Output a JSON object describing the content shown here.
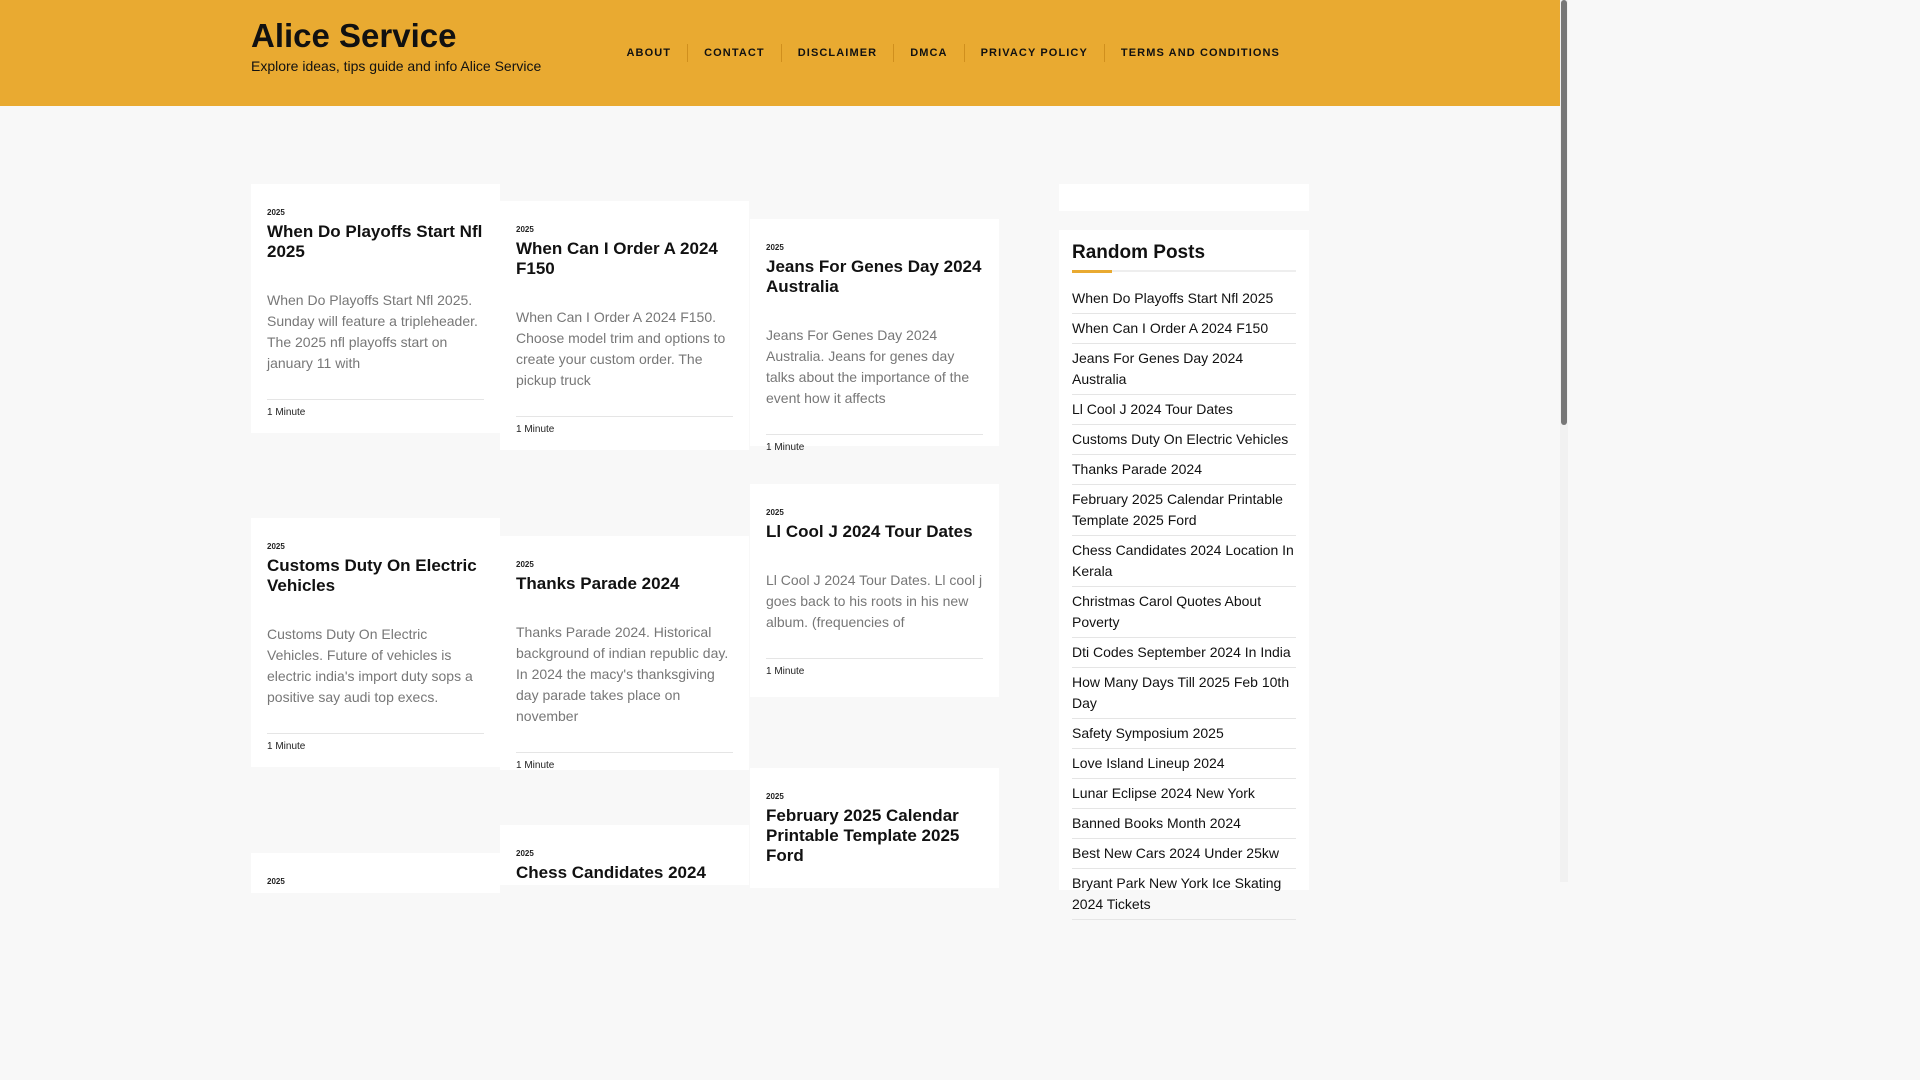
{
  "site": {
    "title": "Alice Service",
    "tagline": "Explore ideas, tips guide and info Alice Service"
  },
  "nav": [
    "ABOUT",
    "CONTACT",
    "DISCLAIMER",
    "DMCA",
    "PRIVACY POLICY",
    "TERMS AND CONDITIONS"
  ],
  "posts": [
    {
      "year": "2025",
      "title": "When Do Playoffs Start Nfl 2025",
      "excerpt": "When Do Playoffs Start Nfl 2025. Sunday will feature a tripleheader. The 2025 nfl playoffs start on january 11 with",
      "read_time": "1 Minute"
    },
    {
      "year": "2025",
      "title": "When Can I Order A 2024 F150",
      "excerpt": "When Can I Order A 2024 F150. Choose model trim and options to create your custom order. The pickup truck",
      "read_time": "1 Minute"
    },
    {
      "year": "2025",
      "title": "Jeans For Genes Day 2024 Australia",
      "excerpt": "Jeans For Genes Day 2024 Australia. Jeans for genes day talks about the importance of the event how it affects",
      "read_time": "1 Minute"
    },
    {
      "year": "2025",
      "title": "Customs Duty On Electric Vehicles",
      "excerpt": "Customs Duty On Electric Vehicles. Future of vehicles is electric india's import duty sops a positive say audi top execs.",
      "read_time": "1 Minute"
    },
    {
      "year": "2025",
      "title": "Thanks Parade 2024",
      "excerpt": "Thanks Parade 2024. Historical background of indian republic day. In 2024 the macy's thanksgiving day parade takes place on november",
      "read_time": "1 Minute"
    },
    {
      "year": "2025",
      "title": "Ll Cool J 2024 Tour Dates",
      "excerpt": "Ll Cool J 2024 Tour Dates. Ll cool j goes back to his roots in his new album. (frequencies of",
      "read_time": "1 Minute"
    },
    {
      "year": "2025",
      "title": "February 2025 Calendar Printable Template 2025 Ford",
      "excerpt": "",
      "read_time": ""
    },
    {
      "year": "2025",
      "title": "Chess Candidates 2024",
      "excerpt": "",
      "read_time": ""
    },
    {
      "year": "2025",
      "title": "",
      "excerpt": "",
      "read_time": ""
    }
  ],
  "sidebar": {
    "title": "Random Posts",
    "items": [
      "When Do Playoffs Start Nfl 2025",
      "When Can I Order A 2024 F150",
      "Jeans For Genes Day 2024 Australia",
      "Ll Cool J 2024 Tour Dates",
      "Customs Duty On Electric Vehicles",
      "Thanks Parade 2024",
      "February 2025 Calendar Printable Template 2025 Ford",
      "Chess Candidates 2024 Location In Kerala",
      "Christmas Carol Quotes About Poverty",
      "Dti Codes September 2024 In India",
      "How Many Days Till 2025 Feb 10th Day",
      "Safety Symposium 2025",
      "Love Island Lineup 2024",
      "Lunar Eclipse 2024 New York",
      "Banned Books Month 2024",
      "Best New Cars 2024 Under 25kw",
      "Bryant Park New York Ice Skating 2024 Tickets"
    ]
  },
  "colors": {
    "accent": "#e9aa31",
    "background": "#f8f8f8"
  }
}
